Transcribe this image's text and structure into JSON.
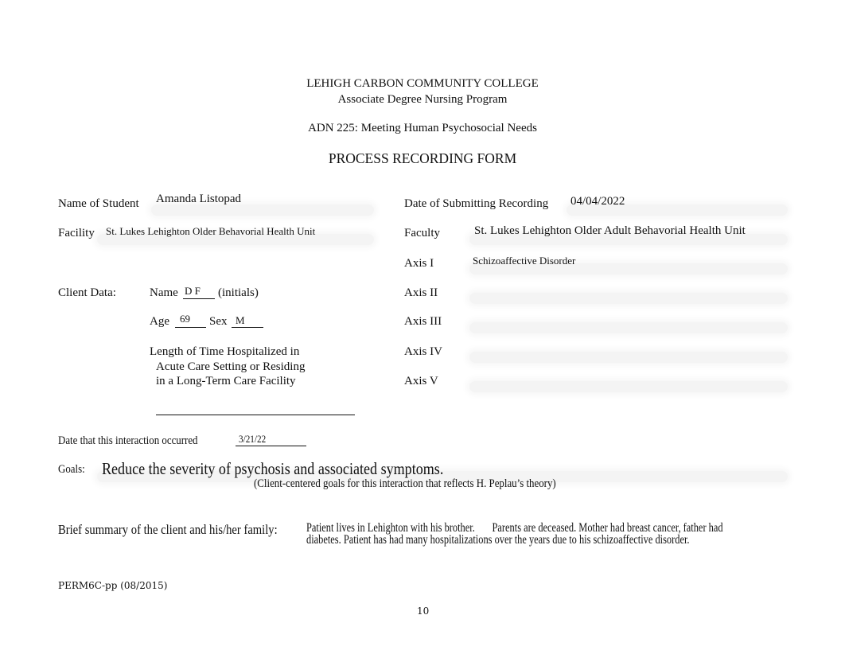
{
  "header": {
    "institution": "LEHIGH CARBON COMMUNITY COLLEGE",
    "program": "Associate Degree Nursing Program",
    "course": "ADN 225:  Meeting Human Psychosocial Needs",
    "form_title": "PROCESS RECORDING FORM"
  },
  "student": {
    "name_label": "Name of Student",
    "name_value": "Amanda Listopad",
    "facility_label": "Facility",
    "facility_value": "St. Lukes Lehighton Older Behavorial Health Unit"
  },
  "submission": {
    "date_label": "Date of Submitting Recording",
    "date_value": "04/04/2022",
    "faculty_label": "Faculty",
    "faculty_value": "St. Lukes Lehighton Older Adult Behavorial Health Unit"
  },
  "axes": [
    {
      "label": "Axis I",
      "value": "Schizoaffective Disorder"
    },
    {
      "label": "Axis II",
      "value": ""
    },
    {
      "label": "Axis III",
      "value": ""
    },
    {
      "label": "Axis IV",
      "value": ""
    },
    {
      "label": "Axis V",
      "value": ""
    }
  ],
  "client": {
    "section_label": "Client Data:",
    "name_label": "Name",
    "name_value": "D F",
    "name_suffix": "(initials)",
    "age_label": "Age",
    "age_value": "69",
    "sex_label": "Sex",
    "sex_value": "M",
    "length_label_line1": "Length of Time Hospitalized in",
    "length_label_line2": "Acute Care Setting or Residing",
    "length_label_line3": "in a Long-Term Care Facility",
    "length_value": ""
  },
  "interaction": {
    "date_label": "Date that this interaction occurred",
    "date_value": "3/21/22"
  },
  "goals": {
    "label": "Goals:",
    "value": "Reduce the severity of psychosis and associated symptoms.",
    "hint": "(Client-centered goals for this interaction that reflects H. Peplau’s theory)"
  },
  "summary": {
    "label": "Brief summary of the client and his/her family:",
    "line1": "Patient lives in Lehighton with his brother.       Parents are deceased. Mother had breast cancer, father had",
    "line2": "diabetes. Patient has had many hospitalizations over the years due to his schizoaffective disorder."
  },
  "footer": {
    "form_code": "PERM6C-pp (08/2015)",
    "page_number": "10"
  }
}
